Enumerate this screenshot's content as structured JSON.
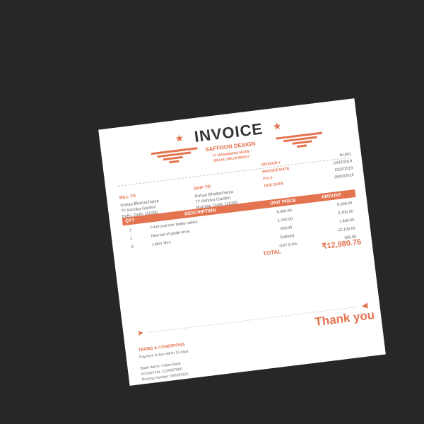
{
  "invoice": {
    "title": "INVOICE",
    "company": "SAFFRON DESIGN",
    "company_addr_line_1": "77 MANAMANA MODE",
    "company_addr_line_2": "DELHI, DELHI 000017",
    "bill_to": {
      "title": "BILL TO",
      "lines": [
        "Rohan Bhattacharya",
        "77 Ashoka Garden",
        "Delhi, Delhi 111000"
      ]
    },
    "ship_to": {
      "title": "SHIP TO",
      "lines": [
        "Rohan Bhattacharya",
        "77 Ashoka Garden",
        "Mumbai, Delhi 111000"
      ]
    },
    "meta": [
      {
        "label": "INVOICE #",
        "value": "IN-001"
      },
      {
        "label": "INVOICE DATE",
        "value": "11/02/2019"
      },
      {
        "label": "P.O.#",
        "value": "2312/2019"
      },
      {
        "label": "DUE DATE",
        "value": "26/02/2019"
      }
    ],
    "table": {
      "headers": [
        "QTY",
        "DESCRIPTION",
        "UNIT PRICE",
        "AMOUNT"
      ],
      "rows": [
        {
          "qty": "1",
          "description": "Front and rear brake cables",
          "unit_price": "8,000.00",
          "amount": "8,000.00"
        },
        {
          "qty": "2",
          "description": "New set of pedal arms",
          "unit_price": "1,150.00",
          "amount": "2,300.00"
        },
        {
          "qty": "3",
          "description": "Labor 3hrs",
          "unit_price": "600.00",
          "amount": "1,800.00"
        }
      ],
      "subtotal_label": "Subtotal",
      "subtotal_value": "12,100.00",
      "tax_label": "GST 5.0%",
      "tax_value": "605.00"
    },
    "total_label": "TOTAL",
    "total_value": "₹12,980.76",
    "thanks": "Thank you",
    "terms": {
      "title": "TERMS & CONDITIONS",
      "line_1": "Payment is due within 15 days",
      "line_2": "Bank Name: Indian Bank",
      "line_3": "Account No: 1234567890",
      "line_4": "Routing Number: 987654321"
    }
  },
  "colors": {
    "accent": "#e4734f",
    "paper": "#ffffff",
    "background": "#272727"
  },
  "icons": {
    "left_wing": "left-wing-icon",
    "right_wing": "right-wing-icon",
    "star": "star-icon",
    "arrow": "arrow-icon"
  }
}
